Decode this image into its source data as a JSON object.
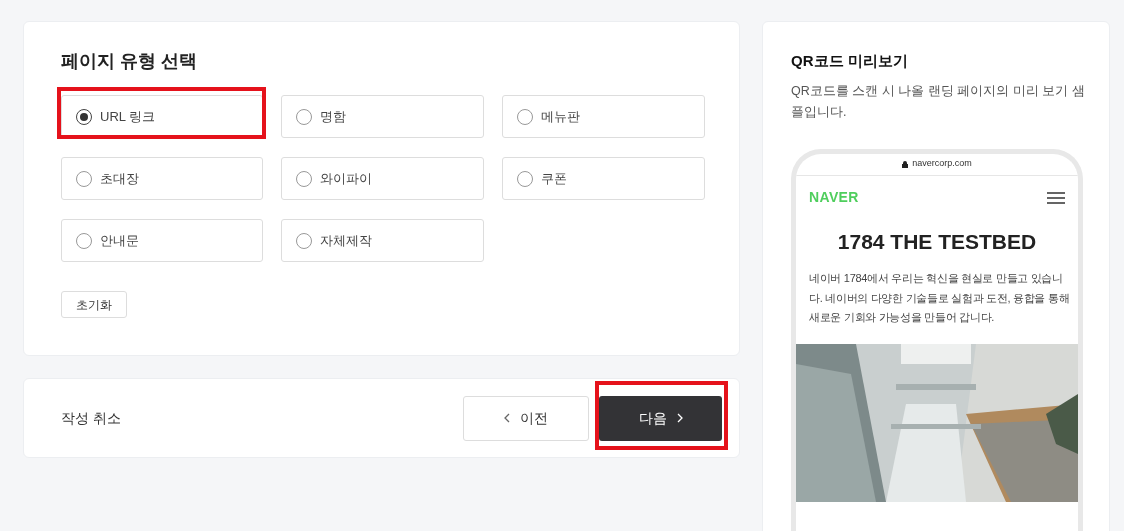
{
  "page_type": {
    "title": "페이지 유형 선택",
    "options": [
      {
        "label": "URL 링크",
        "selected": true,
        "highlighted": true
      },
      {
        "label": "명함",
        "selected": false,
        "highlighted": false
      },
      {
        "label": "메뉴판",
        "selected": false,
        "highlighted": false
      },
      {
        "label": "초대장",
        "selected": false,
        "highlighted": false
      },
      {
        "label": "와이파이",
        "selected": false,
        "highlighted": false
      },
      {
        "label": "쿠폰",
        "selected": false,
        "highlighted": false
      },
      {
        "label": "안내문",
        "selected": false,
        "highlighted": false
      },
      {
        "label": "자체제작",
        "selected": false,
        "highlighted": false
      }
    ],
    "reset_button": "초기화"
  },
  "footer": {
    "cancel": "작성 취소",
    "prev_button": {
      "label": "이전",
      "highlighted": false
    },
    "next_button": {
      "label": "다음",
      "highlighted": true
    }
  },
  "preview": {
    "title": "QR코드 미리보기",
    "description": "QR코드를 스캔 시 나올 랜딩 페이지의 미리 보기 샘플입니다.",
    "phone": {
      "url": "navercorp.com",
      "logo": "NAVER",
      "heading": "1784 THE TESTBED",
      "body": "네이버 1784에서 우리는 혁신을 현실로 만들고 있습니다. 네이버의 다양한 기술들로 실험과 도전, 융합을 통해 새로운 기회와 가능성을 만들어 갑니다."
    }
  }
}
